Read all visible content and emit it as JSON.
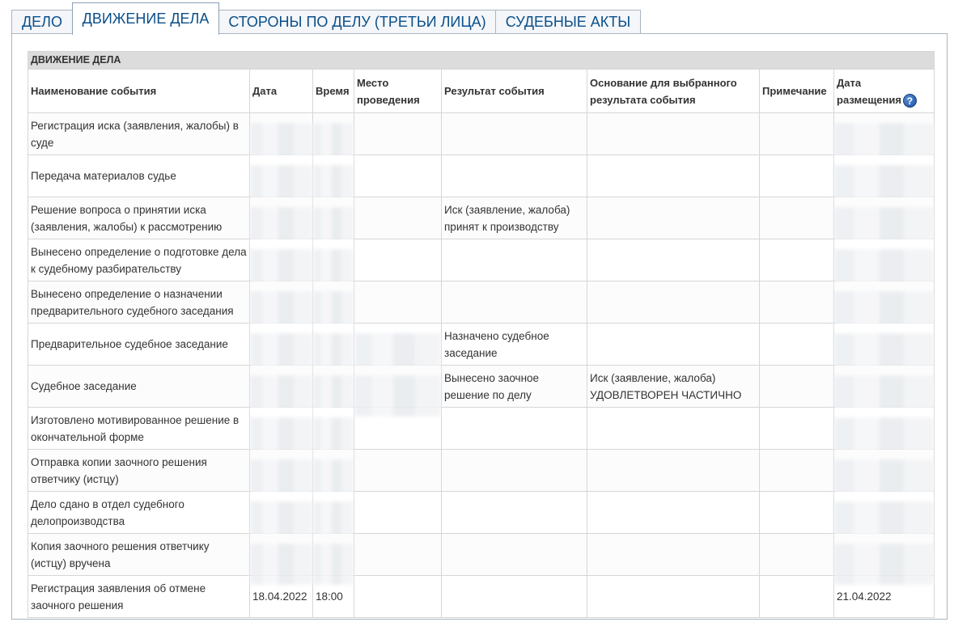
{
  "tabs": [
    {
      "label": "ДЕЛО"
    },
    {
      "label": "ДВИЖЕНИЕ ДЕЛА"
    },
    {
      "label": "СТОРОНЫ ПО ДЕЛУ (ТРЕТЬИ ЛИЦА)"
    },
    {
      "label": "СУДЕБНЫЕ АКТЫ"
    }
  ],
  "active_tab": "ДВИЖЕНИЕ ДЕЛА",
  "table": {
    "caption": "ДВИЖЕНИЕ ДЕЛА",
    "columns": {
      "event": "Наименование события",
      "date": "Дата",
      "time": "Время",
      "place_l1": "Место",
      "place_l2": "проведения",
      "result": "Результат события",
      "basis_l1": "Основание для выбранного",
      "basis_l2": "результата события",
      "note": "Примечание",
      "posted_l1": "Дата",
      "posted_l2": "размещения"
    },
    "help_icon": "help-icon",
    "rows": [
      {
        "event": "Регистрация иска (заявления, жалобы) в суде",
        "result": "",
        "basis": "",
        "date": "",
        "time": "",
        "posted": ""
      },
      {
        "event": "Передача материалов судье",
        "result": "",
        "basis": "",
        "date": "",
        "time": "",
        "posted": ""
      },
      {
        "event": "Решение вопроса о принятии иска (заявления, жалобы) к рассмотрению",
        "result": "Иск (заявление, жалоба) принят к производству",
        "basis": "",
        "date": "",
        "time": "",
        "posted": ""
      },
      {
        "event": "Вынесено определение о подготовке дела к судебному разбирательству",
        "result": "",
        "basis": "",
        "date": "",
        "time": "",
        "posted": ""
      },
      {
        "event": "Вынесено определение о назначении предварительного судебного заседания",
        "result": "",
        "basis": "",
        "date": "",
        "time": "",
        "posted": ""
      },
      {
        "event": "Предварительное судебное заседание",
        "result": "Назначено судебное заседание",
        "basis": "",
        "date": "",
        "time": "",
        "posted": ""
      },
      {
        "event": "Судебное заседание",
        "result": "Вынесено заочное решение по делу",
        "basis": "Иск (заявление, жалоба) УДОВЛЕТВОРЕН ЧАСТИЧНО",
        "date": "",
        "time": "",
        "posted": ""
      },
      {
        "event": "Изготовлено мотивированное решение в окончательной форме",
        "result": "",
        "basis": "",
        "date": "",
        "time": "",
        "posted": ""
      },
      {
        "event": "Отправка копии заочного решения ответчику (истцу)",
        "result": "",
        "basis": "",
        "date": "",
        "time": "",
        "posted": ""
      },
      {
        "event": "Дело сдано в отдел судебного делопроизводства",
        "result": "",
        "basis": "",
        "date": "",
        "time": "",
        "posted": ""
      },
      {
        "event": "Копия заочного решения ответчику (истцу) вручена",
        "result": "",
        "basis": "",
        "date": "",
        "time": "",
        "posted": ""
      },
      {
        "event": "Регистрация заявления об отмене заочного решения",
        "result": "",
        "basis": "",
        "date": "18.04.2022",
        "time": "18:00",
        "posted": "21.04.2022"
      }
    ]
  }
}
